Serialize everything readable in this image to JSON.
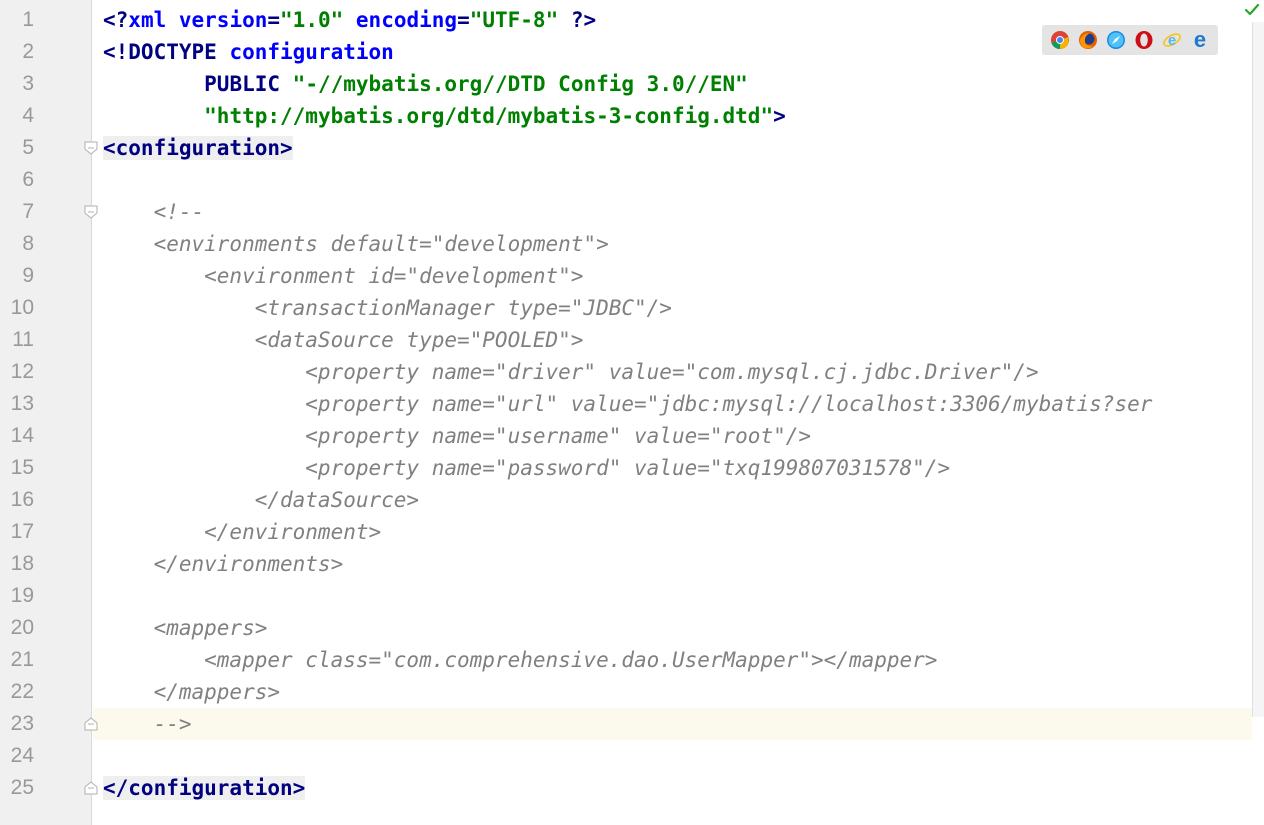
{
  "editor": {
    "lines": [
      {
        "num": "1",
        "tokens": [
          [
            "tag",
            "<?"
          ],
          [
            "attr",
            "xml version"
          ],
          [
            "tag",
            "="
          ],
          [
            "str",
            "\"1.0\""
          ],
          [
            "plain",
            " "
          ],
          [
            "attr",
            "encoding"
          ],
          [
            "tag",
            "="
          ],
          [
            "str",
            "\"UTF-8\" "
          ],
          [
            "tag",
            "?>"
          ]
        ]
      },
      {
        "num": "2",
        "tokens": [
          [
            "tag",
            "<!DOCTYPE "
          ],
          [
            "attr",
            "configuration"
          ]
        ]
      },
      {
        "num": "3",
        "tokens": [
          [
            "plain",
            "        "
          ],
          [
            "tag",
            "PUBLIC "
          ],
          [
            "str",
            "\"-//mybatis.org//DTD Config 3.0//EN\""
          ]
        ]
      },
      {
        "num": "4",
        "tokens": [
          [
            "plain",
            "        "
          ],
          [
            "str",
            "\"http://mybatis.org/dtd/mybatis-3-config.dtd\""
          ],
          [
            "tag",
            ">"
          ]
        ]
      },
      {
        "num": "5",
        "tokens": [
          [
            "tag",
            "<configuration>"
          ]
        ],
        "hl": true
      },
      {
        "num": "6",
        "tokens": []
      },
      {
        "num": "7",
        "tokens": [
          [
            "cmt",
            "    <!--"
          ]
        ]
      },
      {
        "num": "8",
        "tokens": [
          [
            "cmt",
            "    <environments default=\"development\">"
          ]
        ]
      },
      {
        "num": "9",
        "tokens": [
          [
            "cmt",
            "        <environment id=\"development\">"
          ]
        ]
      },
      {
        "num": "10",
        "tokens": [
          [
            "cmt",
            "            <transactionManager type=\"JDBC\"/>"
          ]
        ]
      },
      {
        "num": "11",
        "tokens": [
          [
            "cmt",
            "            <dataSource type=\"POOLED\">"
          ]
        ]
      },
      {
        "num": "12",
        "tokens": [
          [
            "cmt",
            "                <property name=\"driver\" value=\"com.mysql.cj.jdbc.Driver\"/>"
          ]
        ]
      },
      {
        "num": "13",
        "tokens": [
          [
            "cmt",
            "                <property name=\"url\" value=\"jdbc:mysql://localhost:3306/mybatis?ser"
          ]
        ]
      },
      {
        "num": "14",
        "tokens": [
          [
            "cmt",
            "                <property name=\"username\" value=\"root\"/>"
          ]
        ]
      },
      {
        "num": "15",
        "tokens": [
          [
            "cmt",
            "                <property name=\"password\" value=\"txq199807031578\"/>"
          ]
        ]
      },
      {
        "num": "16",
        "tokens": [
          [
            "cmt",
            "            </dataSource>"
          ]
        ]
      },
      {
        "num": "17",
        "tokens": [
          [
            "cmt",
            "        </environment>"
          ]
        ]
      },
      {
        "num": "18",
        "tokens": [
          [
            "cmt",
            "    </environments>"
          ]
        ]
      },
      {
        "num": "19",
        "tokens": []
      },
      {
        "num": "20",
        "tokens": [
          [
            "cmt",
            "    <mappers>"
          ]
        ]
      },
      {
        "num": "21",
        "tokens": [
          [
            "cmt",
            "        <mapper class=\"com.comprehensive.dao.UserMapper\"></mapper>"
          ]
        ]
      },
      {
        "num": "22",
        "tokens": [
          [
            "cmt",
            "    </mappers>"
          ]
        ]
      },
      {
        "num": "23",
        "tokens": [
          [
            "cmt",
            "    -->"
          ]
        ],
        "caret": true
      },
      {
        "num": "24",
        "tokens": []
      },
      {
        "num": "25",
        "tokens": [
          [
            "tag",
            "</configuration>"
          ]
        ],
        "hl": true
      }
    ],
    "fold_lines": [
      "5",
      "7",
      "23",
      "25"
    ]
  },
  "browser_icons": [
    "chrome-icon",
    "firefox-icon",
    "safari-icon",
    "opera-icon",
    "internet-explorer-icon",
    "edge-icon"
  ],
  "colors": {
    "tag": "#000080",
    "attr": "#0000ff",
    "string": "#008000",
    "comment": "#808080",
    "gutter_bg": "#f0f0f0",
    "caret_row_bg": "#fcfaed",
    "status_ok": "#2aa52a"
  }
}
